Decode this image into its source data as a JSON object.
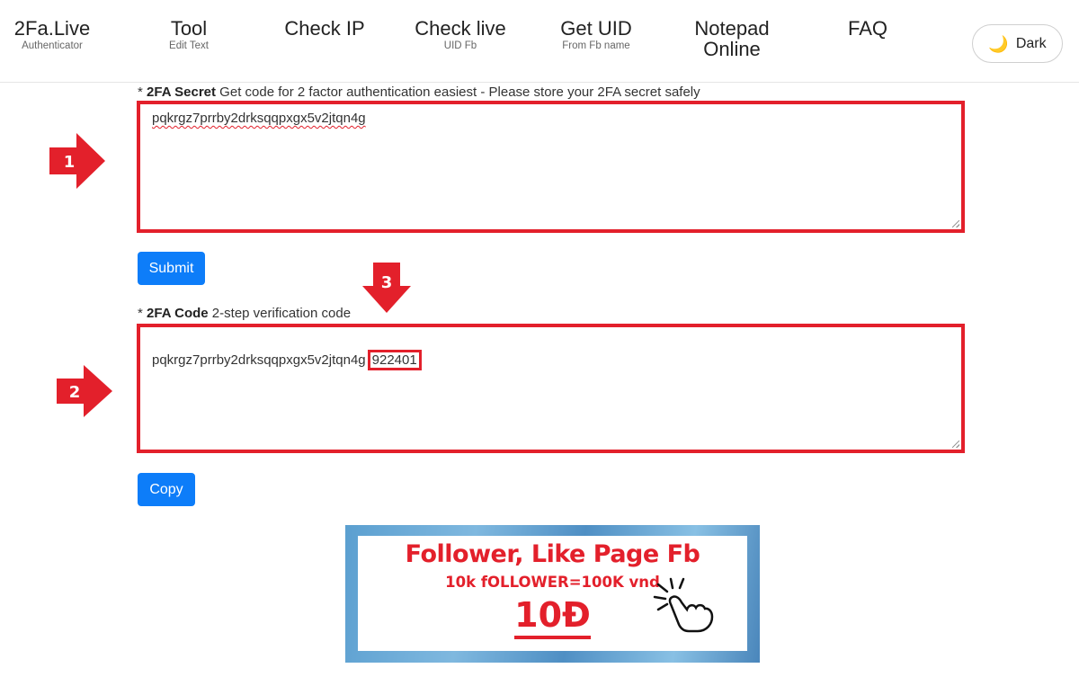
{
  "nav": {
    "items": [
      {
        "label": "2Fa.Live",
        "sub": "Authenticator"
      },
      {
        "label": "Tool",
        "sub": "Edit Text"
      },
      {
        "label": "Check IP",
        "sub": ""
      },
      {
        "label": "Check live",
        "sub": "UID Fb"
      },
      {
        "label": "Get UID",
        "sub": "From Fb name"
      },
      {
        "label": "Notepad",
        "sub": ""
      },
      {
        "label": "FAQ",
        "sub": ""
      }
    ],
    "notepad_line2": "Online",
    "dark_label": "Dark",
    "dark_icon": "banana-icon"
  },
  "secret": {
    "prefix": "* ",
    "title": "2FA Secret",
    "description": " Get code for 2 factor authentication easiest - Please store your 2FA secret safely",
    "value": "pqkrgz7prrby2drksqqpxgx5v2jtqn4g"
  },
  "submit_label": "Submit",
  "code": {
    "prefix": "* ",
    "title": "2FA Code",
    "description": " 2-step verification code",
    "secret_part": "pqkrgz7prrby2drksqqpxgx5v2jtqn4g",
    "otp": "922401"
  },
  "copy_label": "Copy",
  "annotations": {
    "arrow1": "1",
    "arrow2": "2",
    "arrow3": "3",
    "color": "#e3202b"
  },
  "ad": {
    "title": "Follower, Like Page Fb",
    "subtitle": "10k fOLLOWER=100K vnd",
    "price": "10Đ"
  },
  "colors": {
    "accent": "#0d7df9",
    "highlight": "#e3202b"
  }
}
